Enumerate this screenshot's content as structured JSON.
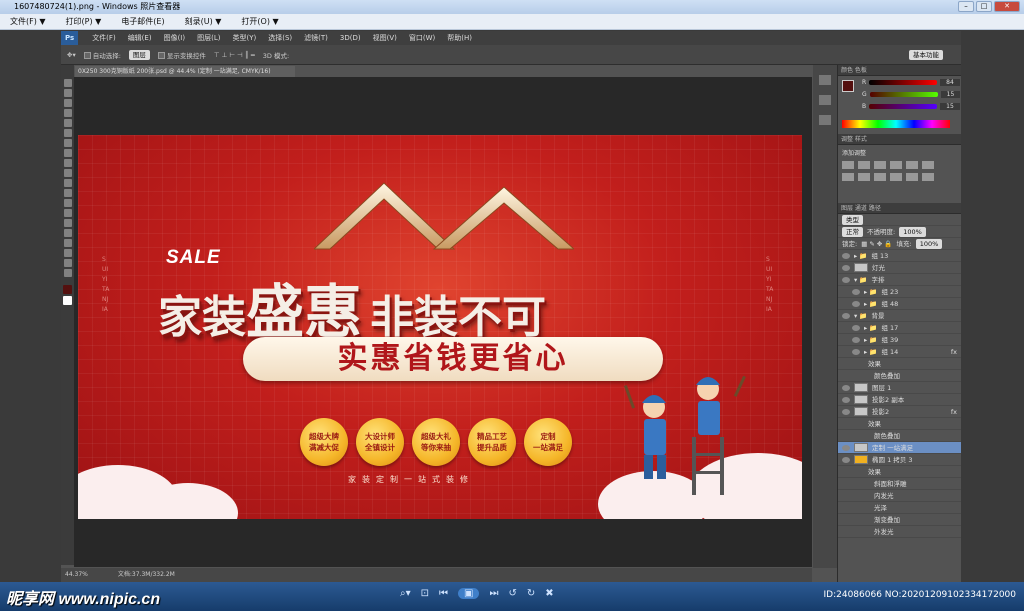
{
  "viewer": {
    "title": "1607480724(1).png - Windows 照片查看器",
    "menu": [
      "文件(F) ▼",
      "打印(P) ▼",
      "电子邮件(E)",
      "刻录(U) ▼",
      "打开(O) ▼"
    ],
    "watermark": "昵享网 www.nipic.cn",
    "id_text": "ID:24086066 NO:20201209102334172000"
  },
  "ps": {
    "logo": "Ps",
    "menu": [
      "文件(F)",
      "编辑(E)",
      "图像(I)",
      "图层(L)",
      "类型(Y)",
      "选择(S)",
      "滤镜(T)",
      "3D(D)",
      "视图(V)",
      "窗口(W)",
      "帮助(H)"
    ],
    "options": {
      "auto_select": "自动选择:",
      "group": "图层",
      "transform": "显示变换控件",
      "mode3d": "3D 模式:"
    },
    "workspace": "基本功能",
    "doc_tab": "0X250  300克铜版纸 200张.psd @ 44.4% (定制 一站满足, CMYK/16)",
    "status_zoom": "44.37%",
    "status_doc": "文档:37.3M/332.2M"
  },
  "banner": {
    "sale": "SALE",
    "headline_a": "家装",
    "headline_b": "盛惠",
    "headline_c": "非装不可",
    "sub": "实惠省钱更省心",
    "badges": [
      {
        "l1": "超级大牌",
        "l2": "满减大促"
      },
      {
        "l1": "大设计师",
        "l2": "全镇设计"
      },
      {
        "l1": "超级大礼",
        "l2": "等你来抽"
      },
      {
        "l1": "精品工艺",
        "l2": "提升品质"
      },
      {
        "l1": "定制",
        "l2": "一站满足"
      }
    ],
    "tagline": "家装定制一站式装修",
    "vtext_left": "SUIYITANJIA",
    "vtext_right": "SUIYITANJIA"
  },
  "panel": {
    "color_tab": "颜色  色板",
    "rgb": [
      {
        "k": "R",
        "v": "84"
      },
      {
        "k": "G",
        "v": "15"
      },
      {
        "k": "B",
        "v": "15"
      }
    ],
    "adjust_tab": "调整  样式",
    "adjust_title": "添加调整",
    "layers_tab": "图层  通道  路径",
    "kind": "类型",
    "blend": "正常",
    "opacity_label": "不透明度:",
    "opacity": "100%",
    "lock_label": "锁定:",
    "fill_label": "填充:",
    "fill": "100%",
    "layers": [
      "组 13",
      "灯光",
      "字排",
      "组 23",
      "组 48",
      "背景",
      "组 17",
      "组 39",
      "组 14",
      "效果",
      "颜色叠加",
      "图层 1",
      "投影2 副本",
      "投影2",
      "效果",
      "颜色叠加",
      "定制 一站满足",
      "椭圆 1 拷贝 3",
      "效果",
      "斜面和浮雕",
      "内发光",
      "光泽",
      "渐变叠加",
      "外发光"
    ]
  }
}
